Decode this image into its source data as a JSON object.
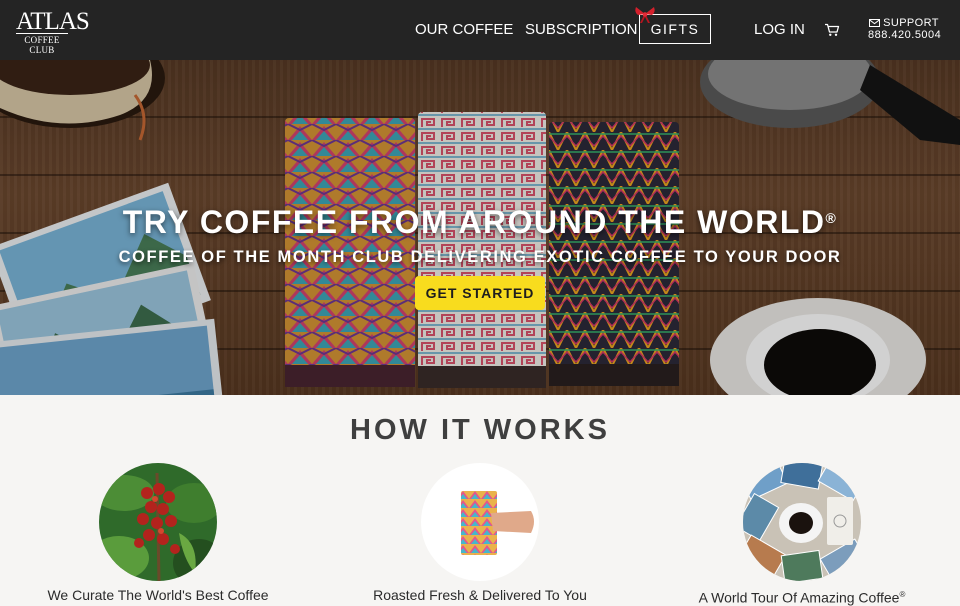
{
  "header": {
    "logo_main": "ATLAS",
    "logo_sub": "COFFEE CLUB",
    "nav": {
      "our_coffee": "OUR COFFEE",
      "subscription": "SUBSCRIPTION",
      "gifts": "GIFTS",
      "login": "LOG IN"
    },
    "support_label": "SUPPORT",
    "support_phone": "888.420.5004"
  },
  "hero": {
    "title": "TRY COFFEE FROM AROUND THE WORLD",
    "title_mark": "®",
    "subtitle": "COFFEE OF THE MONTH CLUB DELIVERING EXOTIC COFFEE TO YOUR DOOR",
    "cta": "GET STARTED"
  },
  "how_it_works": {
    "title": "HOW IT WORKS",
    "steps": [
      {
        "label": "We Curate The World's Best Coffee"
      },
      {
        "label": "Roasted Fresh & Delivered To You"
      },
      {
        "label": "A World Tour Of Amazing Coffee",
        "mark": "®"
      }
    ]
  },
  "colors": {
    "header_bg": "#242424",
    "cta_bg": "#f8dc1e",
    "section_bg": "#f6f5f3",
    "heading_text": "#3f3f3f"
  },
  "icons": [
    "gift-bow-icon",
    "cart-icon",
    "envelope-icon"
  ]
}
